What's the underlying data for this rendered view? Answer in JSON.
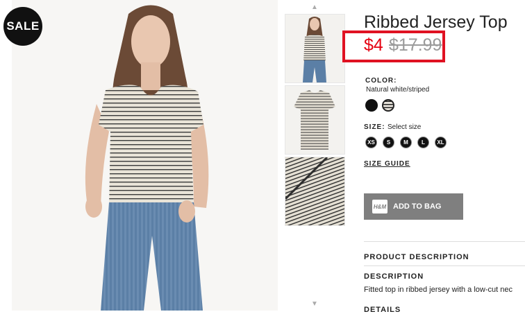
{
  "badge": {
    "label": "SALE"
  },
  "product": {
    "title": "Ribbed Jersey Top",
    "sale_price": "$4",
    "old_price": "$17.99"
  },
  "color": {
    "label": "COLOR:",
    "value": "Natural white/striped",
    "swatches": [
      {
        "name": "black",
        "hex": "#111111"
      },
      {
        "name": "natural white/striped",
        "hex": "#e8e4dc",
        "selected": true
      }
    ]
  },
  "size": {
    "label": "SIZE:",
    "placeholder": "Select size",
    "options": [
      "XS",
      "S",
      "M",
      "L",
      "XL"
    ]
  },
  "size_guide": {
    "label": "SIZE GUIDE"
  },
  "add_to_bag": {
    "label": "ADD TO BAG",
    "icon_text": "H&M",
    "color": "#7f7f7f"
  },
  "product_description": {
    "heading": "PRODUCT DESCRIPTION"
  },
  "description": {
    "heading": "DESCRIPTION",
    "text": "Fitted top in ribbed jersey with a low-cut nec"
  },
  "details": {
    "heading": "DETAILS"
  },
  "gallery": {
    "up_icon": "▲",
    "down_icon": "▼"
  },
  "colors": {
    "sale_red": "#e50010",
    "highlight_box": "#e01222"
  }
}
